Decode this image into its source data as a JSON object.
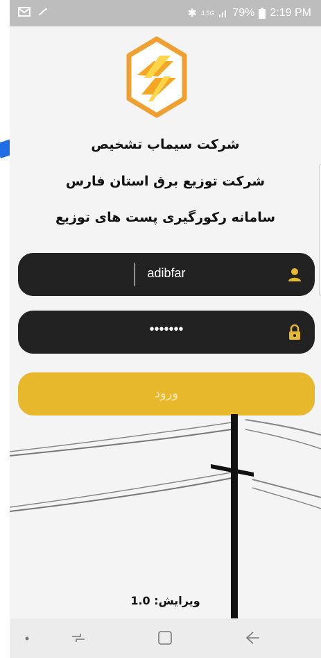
{
  "status_bar": {
    "time": "2:19 PM",
    "battery": "79%",
    "network": "4.5G",
    "icons": [
      "mail-icon",
      "voicemail-icon",
      "bluetooth-icon",
      "signal-icon",
      "battery-icon"
    ]
  },
  "header": {
    "company": "شرکت سیماب تشخیص",
    "distributor": "شرکت توزیع برق استان فارس",
    "system": "سامانه رکورگیری پست های توزیع"
  },
  "form": {
    "username_value": "adibfar",
    "password_value": "•••••••",
    "login_label": "ورود"
  },
  "footer": {
    "version": "ویرایش: 1.0"
  },
  "colors": {
    "accent": "#e8b82c",
    "field_bg": "#222222",
    "logo_orange": "#f0a030"
  }
}
